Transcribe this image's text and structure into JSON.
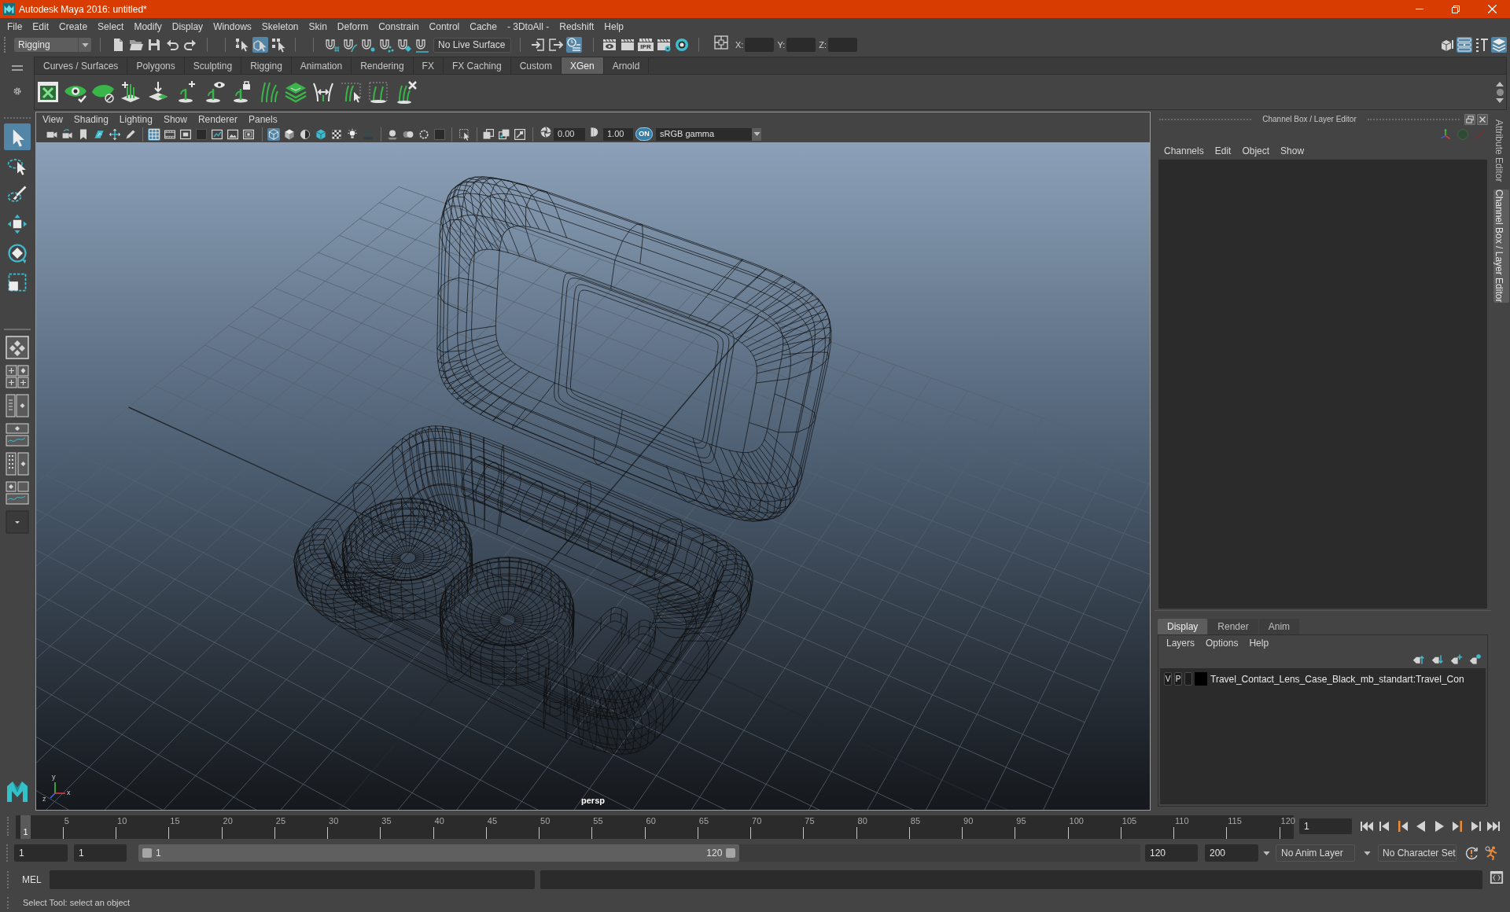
{
  "window": {
    "title": "Autodesk Maya 2016: untitled*"
  },
  "menu_bar": [
    "File",
    "Edit",
    "Create",
    "Select",
    "Modify",
    "Display",
    "Windows",
    "Skeleton",
    "Skin",
    "Deform",
    "Constrain",
    "Control",
    "Cache",
    "- 3DtoAll -",
    "Redshift",
    "Help"
  ],
  "status_line": {
    "menu_set": "Rigging",
    "selection_mode_toggles": [
      {
        "on": false
      },
      {
        "on": true
      },
      {
        "on": false
      }
    ],
    "live_surface": "No Live Surface",
    "history_toggles": [
      {
        "on": false
      },
      {
        "on": false
      },
      {
        "on": true
      }
    ],
    "ipr_label": "IPR",
    "coordinate_labels": [
      "X:",
      "Y:",
      "Z:"
    ],
    "panel_toggles": [
      {
        "on": false
      },
      {
        "on": true
      },
      {
        "on": false
      },
      {
        "on": true
      }
    ]
  },
  "shelf": {
    "tabs": [
      {
        "label": "Curves / Surfaces",
        "selected": false
      },
      {
        "label": "Polygons",
        "selected": false
      },
      {
        "label": "Sculpting",
        "selected": false
      },
      {
        "label": "Rigging",
        "selected": false
      },
      {
        "label": "Animation",
        "selected": false
      },
      {
        "label": "Rendering",
        "selected": false
      },
      {
        "label": "FX",
        "selected": false
      },
      {
        "label": "FX Caching",
        "selected": false
      },
      {
        "label": "Custom",
        "selected": false
      },
      {
        "label": "XGen",
        "selected": true
      },
      {
        "label": "Arnold",
        "selected": false
      }
    ]
  },
  "toolbox": {
    "tools": [
      {
        "selected": true
      },
      {
        "selected": false
      },
      {
        "selected": false
      },
      {
        "selected": false
      },
      {
        "selected": false
      },
      {
        "selected": false
      }
    ]
  },
  "viewport": {
    "menus": [
      "View",
      "Shading",
      "Lighting",
      "Show",
      "Renderer",
      "Panels"
    ],
    "display_toggles": [
      {
        "on": true
      },
      {
        "on": false
      },
      {
        "on": false
      },
      {
        "on": false
      },
      {
        "on": false
      },
      {
        "on": false
      },
      {
        "on": false
      }
    ],
    "shading_toggles": [
      {
        "on": true
      },
      {
        "on": false
      },
      {
        "on": false
      },
      {
        "on": false
      },
      {
        "on": false
      },
      {
        "on": false
      },
      {
        "on": false
      }
    ],
    "exposure": "0.00",
    "gamma": "1.00",
    "color_management": {
      "label": "ON",
      "on": true
    },
    "color_space": "sRGB gamma",
    "axis_labels": [
      "y",
      "z",
      "x"
    ],
    "camera_label": "persp"
  },
  "channel_box": {
    "title": "Channel Box / Layer Editor",
    "menus": [
      "Channels",
      "Edit",
      "Object",
      "Show"
    ]
  },
  "layer_editor": {
    "tabs": [
      {
        "label": "Display",
        "selected": true
      },
      {
        "label": "Render",
        "selected": false
      },
      {
        "label": "Anim",
        "selected": false
      }
    ],
    "menus": [
      "Layers",
      "Options",
      "Help"
    ],
    "layers": [
      {
        "visibility": "V",
        "playback": "P",
        "color": "#000000",
        "name": "Travel_Contact_Lens_Case_Black_mb_standart:Travel_Con"
      }
    ]
  },
  "side_tabs": [
    {
      "label": "Attribute Editor",
      "selected": false
    },
    {
      "label": "Channel Box / Layer Editor",
      "selected": true
    }
  ],
  "timeline": {
    "current_frame": "1",
    "level": 0,
    "tick_labels": [
      "5",
      "10",
      "15",
      "20",
      "25",
      "30",
      "35",
      "40",
      "45",
      "50",
      "55",
      "60",
      "65",
      "70",
      "75",
      "80",
      "85",
      "90",
      "95",
      "100",
      "105",
      "110",
      "115",
      "120"
    ],
    "frame_field": "1"
  },
  "range_slider": {
    "animation_start": "1",
    "playback_start": "1",
    "start_label": "1",
    "end_label": "120",
    "level": 0.6,
    "playback_end": "120",
    "animation_end": "200",
    "anim_layer": "No Anim Layer",
    "character_set": "No Character Set"
  },
  "command_line": {
    "language": "MEL"
  },
  "help_line": "Select Tool: select an object"
}
